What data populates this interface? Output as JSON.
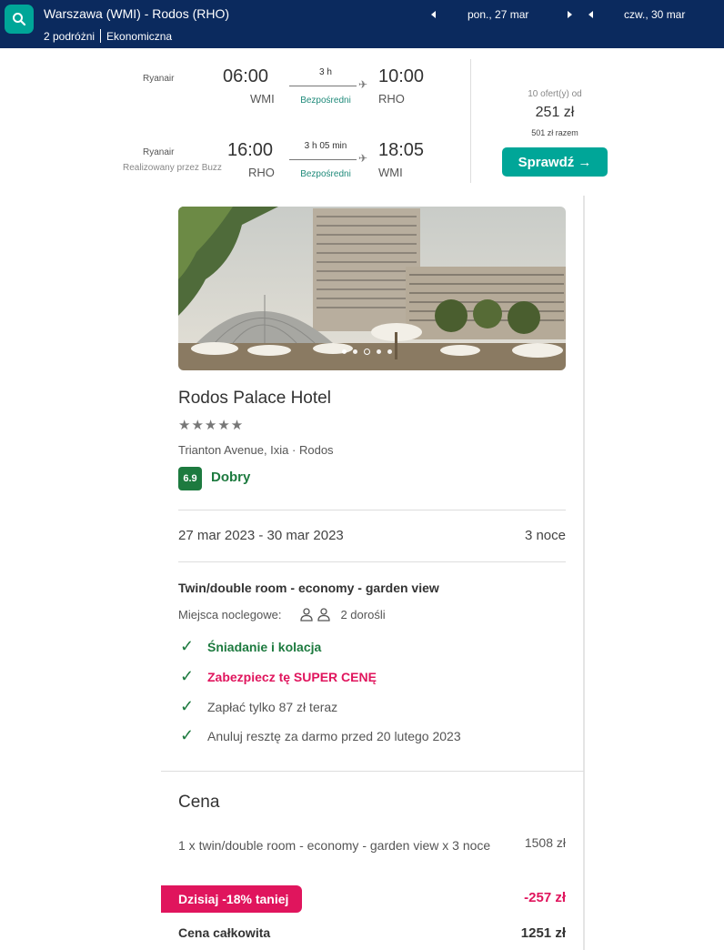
{
  "search": {
    "route": "Warszawa (WMI) - Rodos (RHO)",
    "travellers": "2 podróżni",
    "cabin": "Ekonomiczna",
    "depart_date": "pon., 27 mar",
    "return_date": "czw., 30 mar"
  },
  "flight": {
    "outbound": {
      "airline": "Ryanair",
      "dep_time": "06:00",
      "dep_code": "WMI",
      "duration": "3 h",
      "stops": "Bezpośredni",
      "arr_time": "10:00",
      "arr_code": "RHO"
    },
    "operated_by": "Realizowany przez Buzz",
    "inbound": {
      "airline": "Ryanair",
      "dep_time": "16:00",
      "dep_code": "RHO",
      "duration": "3 h 05 min",
      "stops": "Bezpośredni",
      "arr_time": "18:05",
      "arr_code": "WMI"
    },
    "offers": "10 ofert(y) od",
    "price": "251 zł",
    "price_total": "501 zł razem",
    "check_label": "Sprawdź →"
  },
  "hotel": {
    "name": "Rodos Palace Hotel",
    "stars": "★★★★★",
    "address": "Trianton Avenue, Ixia · Rodos",
    "rating": "6.9",
    "rating_label": "Dobry",
    "dates": "27 mar 2023 - 30 mar 2023",
    "nights": "3 noce",
    "room": "Twin/double room - economy - garden view",
    "capacity_label": "Miejsca noclegowe:",
    "capacity_value": "2 dorośli",
    "features": [
      "Śniadanie i kolacja",
      "Zabezpiecz tę SUPER CENĘ",
      "Zapłać tylko 87 zł teraz",
      "Anuluj resztę za darmo przed 20 lutego 2023"
    ]
  },
  "price": {
    "title": "Cena",
    "line_desc": "1 x twin/double room - economy - garden view x 3 noce",
    "line_price": "1508 zł",
    "discount_label": "Dzisiaj -18% taniej",
    "discount_value": "-257 zł",
    "total_label": "Cena całkowita",
    "total_value": "1251 zł"
  },
  "colors": {
    "topbar": "#0b2a5e",
    "accent": "#00a698",
    "green": "#1d7a3f",
    "pink": "#e0155d"
  }
}
